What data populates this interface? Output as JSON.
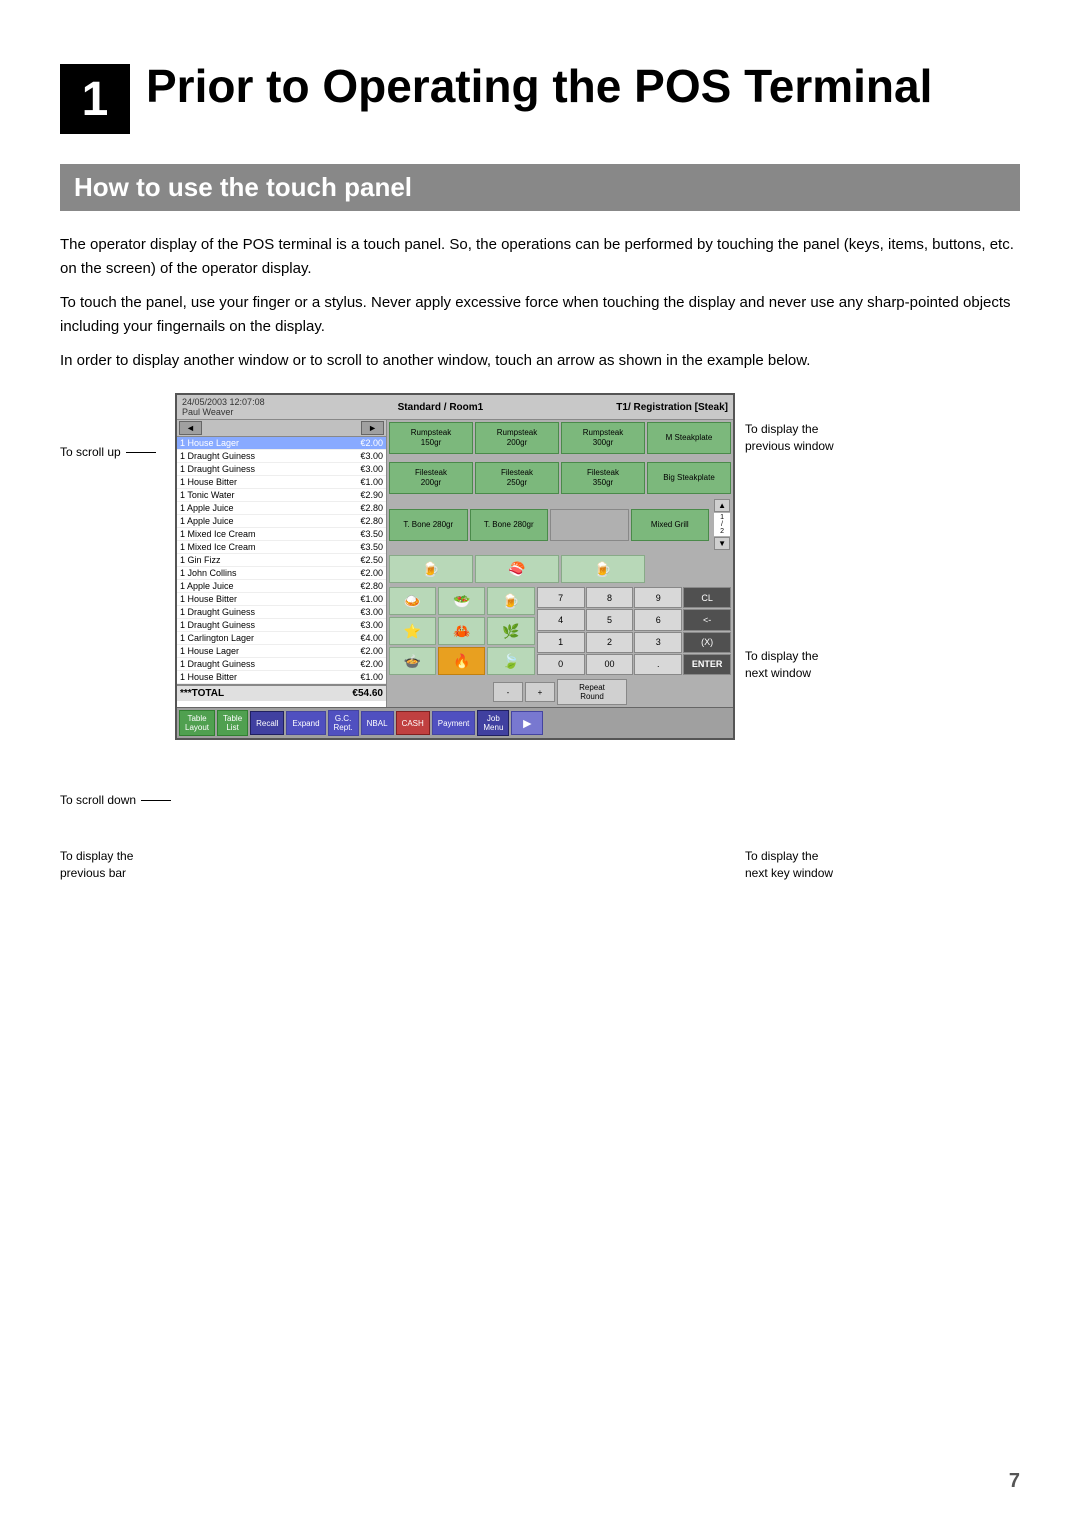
{
  "chapter": {
    "number": "1",
    "title": "Prior to Operating the POS Terminal"
  },
  "section": {
    "heading": "How to use the touch panel"
  },
  "paragraphs": [
    "The operator display of the POS terminal is a touch panel.  So, the operations can be performed by touching the panel (keys, items, buttons, etc. on the screen) of the operator display.",
    "To touch the panel, use your finger or a stylus.  Never apply excessive force when touching the display and never use any sharp-pointed objects including your fingernails on the display.",
    "In order to display another window or to scroll to another window, touch an arrow as shown in the example below."
  ],
  "diagram": {
    "labels": {
      "scroll_up": "To scroll up",
      "scroll_down": "To scroll down",
      "prev_bar": "To display the\nprevious bar",
      "prev_window": "To display the\nprevious window",
      "next_window": "To display the\nnext window",
      "next_key": "To display the\nnext key window"
    },
    "pos": {
      "header": {
        "datetime": "24/05/2003 12:07:08",
        "user": "Paul Weaver",
        "room": "Standard / Room1",
        "registration": "T1/ Registration [Steak]"
      },
      "order_items": [
        {
          "qty": "1",
          "name": "House Lager",
          "price": "€2.00",
          "highlight": true
        },
        {
          "qty": "1",
          "name": "Draught Guiness",
          "price": "€3.00",
          "highlight": false
        },
        {
          "qty": "1",
          "name": "Draught Guiness",
          "price": "€3.00",
          "highlight": false
        },
        {
          "qty": "1",
          "name": "House Bitter",
          "price": "€1.00",
          "highlight": false
        },
        {
          "qty": "1",
          "name": "Tonic Water",
          "price": "€2.90",
          "highlight": false
        },
        {
          "qty": "1",
          "name": "Apple Juice",
          "price": "€2.80",
          "highlight": false
        },
        {
          "qty": "1",
          "name": "Apple Juice",
          "price": "€2.80",
          "highlight": false
        },
        {
          "qty": "1",
          "name": "Mixed Ice Cream",
          "price": "€3.50",
          "highlight": false
        },
        {
          "qty": "1",
          "name": "Mixed Ice Cream",
          "price": "€3.50",
          "highlight": false
        },
        {
          "qty": "1",
          "name": "Gin Fizz",
          "price": "€2.50",
          "highlight": false
        },
        {
          "qty": "1",
          "name": "John Collins",
          "price": "€2.00",
          "highlight": false
        },
        {
          "qty": "1",
          "name": "Apple Juice",
          "price": "€2.80",
          "highlight": false
        },
        {
          "qty": "1",
          "name": "House Bitter",
          "price": "€1.00",
          "highlight": false
        },
        {
          "qty": "1",
          "name": "Draught Guiness",
          "price": "€3.00",
          "highlight": false
        },
        {
          "qty": "1",
          "name": "Draught Guiness",
          "price": "€3.00",
          "highlight": false
        },
        {
          "qty": "1",
          "name": "Carlington Lager",
          "price": "€4.00",
          "highlight": false
        },
        {
          "qty": "1",
          "name": "House Lager",
          "price": "€2.00",
          "highlight": false
        },
        {
          "qty": "1",
          "name": "Draught Guiness",
          "price": "€2.00",
          "highlight": false
        },
        {
          "qty": "1",
          "name": "House Bitter",
          "price": "€1.00",
          "highlight": false
        }
      ],
      "total_label": "***TOTAL",
      "total_value": "€54.60",
      "menu_buttons": [
        "Rumpsteak 150gr",
        "Rumpsteak 200gr",
        "Rumpsteak 300gr",
        "M Steakplate",
        "",
        "",
        "",
        "",
        "Filesteak 200gr",
        "Filesteak 250gr",
        "Filesteak 350gr",
        "Big Steakplate",
        "",
        "",
        "",
        "",
        "T. Bone 280gr",
        "T. Bone 280gr",
        "",
        "Mixed Grill"
      ],
      "numpad_buttons": [
        "7",
        "8",
        "9",
        "CL",
        "4",
        "5",
        "6",
        "<-",
        "1",
        "2",
        "3",
        "(X)",
        "0",
        "00",
        ".",
        "ENTER"
      ],
      "ctrl_buttons": [
        "-",
        "+",
        "Repeat Round"
      ],
      "func_buttons": [
        "Table Layout",
        "Table List",
        "Recall",
        "Expand",
        "G.C. Rept.",
        "NBAL",
        "CASH",
        "Payment",
        "Job Menu"
      ],
      "page_indicator": "1 / 2"
    }
  },
  "page_number": "7"
}
